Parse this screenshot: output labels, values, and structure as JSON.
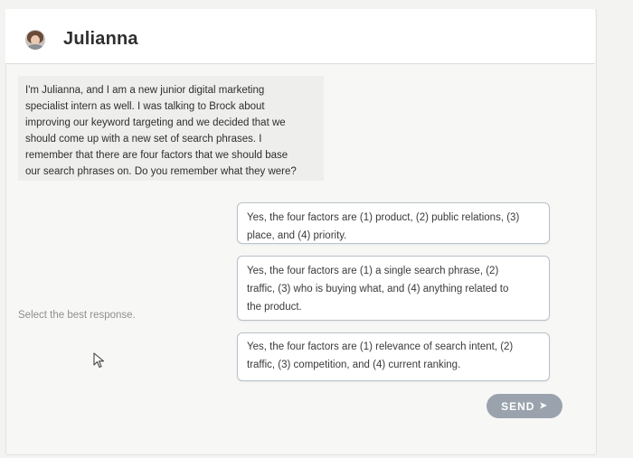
{
  "header": {
    "name": "Julianna",
    "avatar_icon": "person-avatar-icon"
  },
  "message": {
    "lines": [
      "I'm Julianna, and I am a new junior digital marketing",
      "specialist intern as well. I was talking to Brock about",
      "improving our keyword targeting and we decided that we",
      "should come up with a new set of search phrases. I",
      "remember that there are four factors that we should base",
      "our search phrases on. Do you remember what they were?"
    ]
  },
  "prompt": {
    "label": "Select the best response."
  },
  "options": [
    {
      "lines": [
        "Yes, the four factors are (1) product, (2) public relations, (3)",
        "place, and (4) priority."
      ]
    },
    {
      "lines": [
        "Yes, the four factors are (1) a single search phrase, (2)",
        "traffic, (3) who is buying what, and (4) anything related to",
        "the product."
      ]
    },
    {
      "lines": [
        "Yes, the four factors are (1) relevance of search intent, (2)",
        "traffic, (3) competition, and (4) current ranking."
      ]
    }
  ],
  "send": {
    "label": "SEND",
    "arrow": "➤"
  },
  "colors": {
    "send_button": "#9aa3ad",
    "option_border": "#b9c2c8",
    "message_bg": "#eeefec"
  }
}
